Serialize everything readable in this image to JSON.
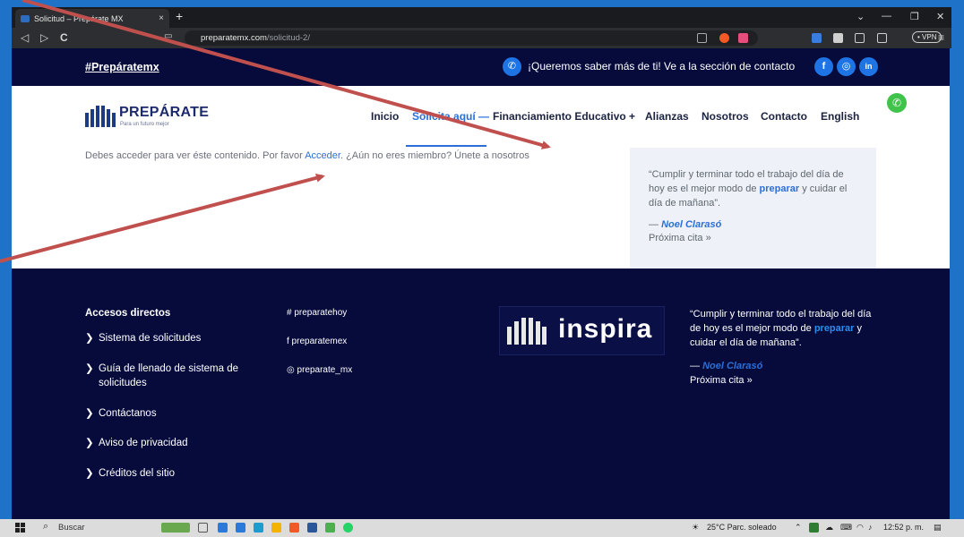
{
  "browser": {
    "tab_title": "Solicitud – Prepárate MX",
    "tab_close": "×",
    "new_tab": "+",
    "url_domain": "preparatemx.com",
    "url_path": "/solicitud-2/",
    "vpn_label": "• VPN",
    "back": "◁",
    "forward": "▷",
    "reload": "C",
    "minimize": "—",
    "maximize": "❐",
    "close": "✕",
    "menu": "≡"
  },
  "site": {
    "top_bar": {
      "hashtag": "#Prepáratemx",
      "contact_text": "¡Queremos saber más de ti! Ve a la sección de contacto",
      "social": [
        "f",
        "◎",
        "in"
      ]
    },
    "logo": {
      "name": "PREPÁRATE",
      "tagline": "Para un futuro mejor"
    },
    "nav": [
      "Inicio",
      "Solicita aquí",
      "Financiamiento Educativo",
      "Alianzas",
      "Nosotros",
      "Contacto",
      "English"
    ],
    "nav_suffixes": {
      "solicita": "—",
      "financiamiento": "+"
    },
    "access_msg": {
      "before": "Debes acceder para ver éste contenido. Por favor ",
      "link": "Acceder",
      "after": ". ¿Aún no eres miembro? Únete a nosotros"
    },
    "quote": {
      "text_before": "“Cumplir y terminar todo el trabajo del día de hoy es el mejor modo de ",
      "highlight": "preparar",
      "text_after": " y cuidar el día de mañana”.",
      "author_dash": "— ",
      "author": "Noel Clarasó",
      "next": "Próxima cita »"
    },
    "footer": {
      "heading": "Accesos directos",
      "links": [
        "Sistema de solicitudes",
        "Guía de llenado de sistema de solicitudes",
        "Contáctanos",
        "Aviso de privacidad",
        "Créditos del sitio"
      ],
      "social": [
        "# preparatehoy",
        "f  preparatemex",
        "◎ preparate_mx"
      ],
      "inspira": "inspira",
      "quote_before": "“Cumplir y terminar todo el trabajo del día de hoy es el mejor modo de ",
      "quote_highlight": "preparar",
      "quote_after": " y cuidar el día de mañana”.",
      "author_dash": "— ",
      "author": "Noel Clarasó",
      "next": "Próxima cita »"
    }
  },
  "taskbar": {
    "search": "Buscar",
    "weather": "25°C  Parc. soleado",
    "time": "12:52 p. m."
  },
  "colors": {
    "navy": "#060b3c",
    "accent_blue": "#2a6fd8",
    "arrow_red": "#c0504d",
    "whatsapp": "#3fc34a"
  }
}
